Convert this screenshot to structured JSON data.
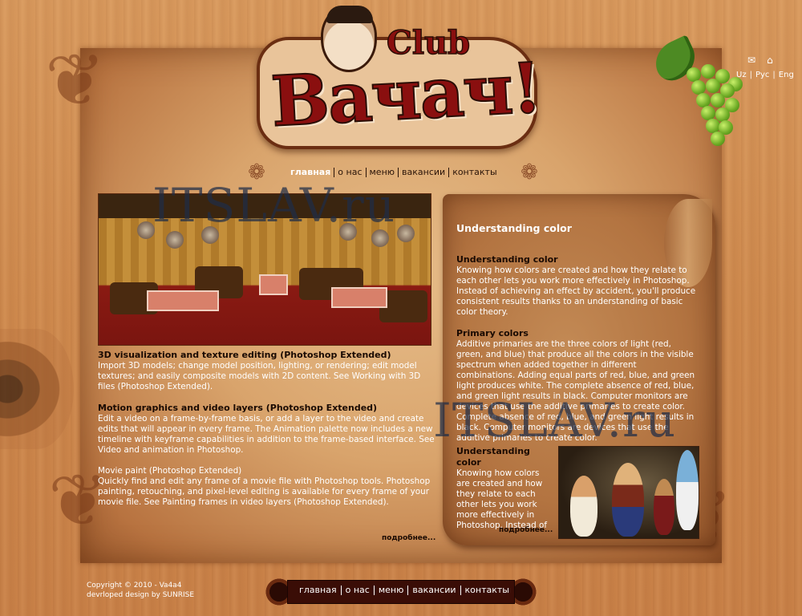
{
  "header": {
    "logo_main": "Вачач!",
    "logo_club": "Club"
  },
  "top_links": {
    "mail_icon": "mail-icon",
    "home_icon": "home-icon",
    "languages": [
      "Uz",
      "Рус",
      "Eng"
    ]
  },
  "nav": {
    "items": [
      "главная",
      "о нас",
      "меню",
      "вакансии",
      "контакты"
    ],
    "active": "главная"
  },
  "left_column": {
    "sections": [
      {
        "title": "3D visualization and texture editing (Photoshop Extended)",
        "body": "Import 3D models; change model position, lighting, or rendering; edit model textures; and easily composite models with 2D content. See Working with 3D files (Photoshop Extended)."
      },
      {
        "title": "Motion graphics and video layers (Photoshop Extended)",
        "body": "Edit a video on a frame-by-frame basis, or add a layer to the video and create edits that will appear in every frame. The Animation palette now includes a new timeline with keyframe capabilities in addition to the frame-based interface. See Video and animation in Photoshop."
      },
      {
        "title": "Movie paint (Photoshop Extended)",
        "body": "Quickly find and edit any frame of a movie file with Photoshop tools. Photoshop painting, retouching, and pixel-level editing is available for every frame of your movie file. See Painting frames in video layers (Photoshop Extended)."
      }
    ],
    "more_label": "подробнее..."
  },
  "right_column": {
    "heading": "Understanding color",
    "sections": [
      {
        "title": "Understanding color",
        "body": "Knowing how colors are created and how they relate to each other lets you work more effectively in Photoshop. Instead of achieving an effect by accident, you'll produce consistent results thanks to an understanding of basic color theory."
      },
      {
        "title": "Primary colors",
        "body": "Additive primaries are the three colors of light (red, green, and blue) that produce all the colors in the visible spectrum when added together in different combinations. Adding equal parts of red, blue, and green light produces white. The complete absence of red, blue, and green light results in black. Computer monitors are devices that use the additive primaries to create color. Complete absence of red, blue, and green light results in black. Computer monitors are devices that use the additive primaries to create color."
      }
    ],
    "bottom_block": {
      "title": "Understanding color",
      "body": "Knowing how colors are created and how they relate to each other lets you work more effectively in Photoshop. Instead of achieving an"
    },
    "more_label": "подробнее..."
  },
  "footer": {
    "copyright": "Copyright © 2010 - Va4a4",
    "credit": "devrloped design by SUNRISE",
    "nav": [
      "главная",
      "о нас",
      "меню",
      "вакансии",
      "контакты"
    ]
  },
  "watermark": "ITSLAV.ru",
  "colors": {
    "wood": "#cf8a4e",
    "parchment": "#d9a46c",
    "logo_red": "#8a0f0f",
    "footer_bar": "#3a0d06",
    "grape": "#6aa823"
  }
}
